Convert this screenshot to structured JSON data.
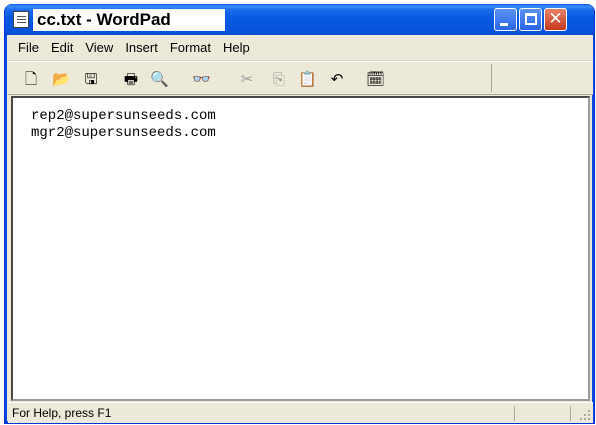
{
  "window": {
    "title": "cc.txt - WordPad"
  },
  "menu": [
    "File",
    "Edit",
    "View",
    "Insert",
    "Format",
    "Help"
  ],
  "toolbar": {
    "tools": [
      {
        "icon": "new-document-icon",
        "glyph": "🗋",
        "enabled": true
      },
      {
        "icon": "open-folder-icon",
        "glyph": "📂",
        "enabled": true
      },
      {
        "icon": "save-icon",
        "glyph": "🖫",
        "enabled": true
      },
      {
        "icon": "print-icon",
        "glyph": "🖶",
        "enabled": true
      },
      {
        "icon": "print-preview-icon",
        "glyph": "🔍",
        "enabled": true
      },
      {
        "icon": "find-icon",
        "glyph": "👓",
        "enabled": true
      },
      {
        "icon": "cut-icon",
        "glyph": "✂",
        "enabled": false
      },
      {
        "icon": "copy-icon",
        "glyph": "⎘",
        "enabled": false
      },
      {
        "icon": "paste-icon",
        "glyph": "📋",
        "enabled": true
      },
      {
        "icon": "undo-icon",
        "glyph": "↶",
        "enabled": true
      },
      {
        "icon": "date-time-icon",
        "glyph": "🗓",
        "enabled": true
      }
    ]
  },
  "document": {
    "lines": [
      "rep2@supersunseeds.com",
      "mgr2@supersunseeds.com"
    ]
  },
  "status": {
    "text": "For Help, press F1"
  }
}
